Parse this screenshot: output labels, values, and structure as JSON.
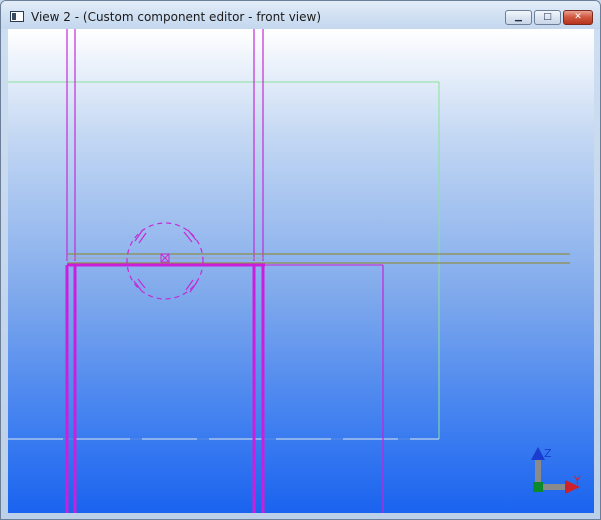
{
  "window": {
    "title": "View 2 - (Custom component editor - front view)",
    "icon": "view-window-icon",
    "buttons": {
      "minimize_icon": "minimize-icon",
      "maximize_icon": "maximize-icon",
      "close_icon": "close-icon"
    }
  },
  "axes": {
    "z_label": "Z",
    "y_label": "Y"
  },
  "colors": {
    "magenta": "#cc22dd",
    "green_outline": "#7be08a",
    "olive": "#8a8a40",
    "axis_blue": "#1a3ccf",
    "axis_red": "#d0202a",
    "axis_green": "#0a8a2a"
  }
}
